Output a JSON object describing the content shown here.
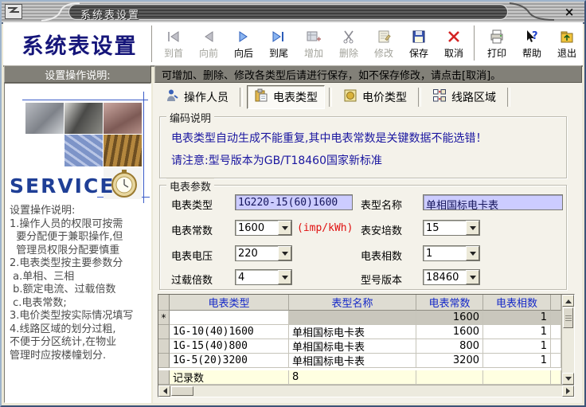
{
  "window": {
    "title": "系统表设置",
    "close_glyph": "×"
  },
  "header": {
    "app_title": "系统表设置"
  },
  "toolbar": {
    "buttons": [
      {
        "label": "到首",
        "icon": "first-arrow-icon",
        "disabled": true
      },
      {
        "label": "向前",
        "icon": "prev-arrow-icon",
        "disabled": true
      },
      {
        "label": "向后",
        "icon": "next-arrow-icon",
        "disabled": false
      },
      {
        "label": "到尾",
        "icon": "last-arrow-icon",
        "disabled": false
      },
      {
        "label": "增加",
        "icon": "add-record-icon",
        "disabled": true
      },
      {
        "label": "删除",
        "icon": "delete-record-icon",
        "disabled": true
      },
      {
        "label": "修改",
        "icon": "edit-record-icon",
        "disabled": true
      },
      {
        "label": "保存",
        "icon": "save-icon",
        "disabled": false
      },
      {
        "label": "取消",
        "icon": "cancel-icon",
        "disabled": false
      },
      {
        "label": "打印",
        "icon": "print-icon",
        "disabled": false
      },
      {
        "label": "帮助",
        "icon": "help-icon",
        "disabled": false
      },
      {
        "label": "退出",
        "icon": "exit-icon",
        "disabled": false
      }
    ]
  },
  "info_bar": {
    "sidebar_title": "设置操作说明:",
    "message": "可增加、删除、修改各类型后请进行保存，如不保存修改，请点击[取消]。"
  },
  "sidebar": {
    "service_text": "SERVICE",
    "instruction_lines": [
      "设置操作说明:",
      "1.操作人员的权限可按需",
      "  要分配便于兼职操作,但",
      "  管理员权限分配要慎重",
      "2.电表类型按主要参数分",
      " a.单相、三相",
      " b.额定电流、过载倍数",
      " c.电表常数;",
      "3.电价类型按实际情况填写",
      "4.线路区域的划分过粗,",
      "不便于分区统计,在物业",
      "管理时应按楼幢划分."
    ]
  },
  "tabs": [
    {
      "label": "操作人员",
      "icon": "operator-icon",
      "active": false
    },
    {
      "label": "电表类型",
      "icon": "meter-type-icon",
      "active": true
    },
    {
      "label": "电价类型",
      "icon": "price-type-icon",
      "active": false
    },
    {
      "label": "线路区域",
      "icon": "line-area-icon",
      "active": false
    }
  ],
  "encoding_box": {
    "title": "编码说明",
    "line1": "电表类型自动生成不能重复,其中电表常数是关键数据不能选错！",
    "line2": "请注意:型号版本为GB/T18460国家新标准"
  },
  "params_box": {
    "title": "电表参数",
    "meter_type": {
      "label": "电表类型",
      "value": "1G220-15(60)1600"
    },
    "model_name": {
      "label": "表型名称",
      "value": "单相国标电卡表"
    },
    "meter_constant": {
      "label": "电表常数",
      "value": "1600",
      "unit": "(imp/kWh)"
    },
    "ampere": {
      "label": "表安培数",
      "value": "15"
    },
    "voltage": {
      "label": "电表电压",
      "value": "220"
    },
    "phase": {
      "label": "电表相数",
      "value": "1"
    },
    "overload": {
      "label": "过载倍数",
      "value": "4"
    },
    "model_version": {
      "label": "型号版本",
      "value": "18460"
    }
  },
  "grid": {
    "columns": [
      "电表类型",
      "表型名称",
      "电表常数",
      "电表相数"
    ],
    "new_row_marker": "*",
    "rows": [
      {
        "meter_type": "",
        "model_name": "",
        "constant": "1600",
        "phase": "1"
      },
      {
        "meter_type": "1G-10(40)1600",
        "model_name": "单相国标电卡表",
        "constant": "1600",
        "phase": "1"
      },
      {
        "meter_type": "1G-15(40)800",
        "model_name": "单相国标电卡表",
        "constant": "800",
        "phase": "1"
      },
      {
        "meter_type": "1G-5(20)3200",
        "model_name": "单相国标电卡表",
        "constant": "3200",
        "phase": "1"
      }
    ],
    "footer": {
      "label": "记录数",
      "value": "8"
    }
  },
  "colors": {
    "accent_navy": "#16167a",
    "notice_blue": "#1a16a0",
    "field_lavender": "#ccccff",
    "grid_header_blue": "#1428c8",
    "unit_red": "#e01010",
    "footer_yellow": "#ffffe1"
  }
}
